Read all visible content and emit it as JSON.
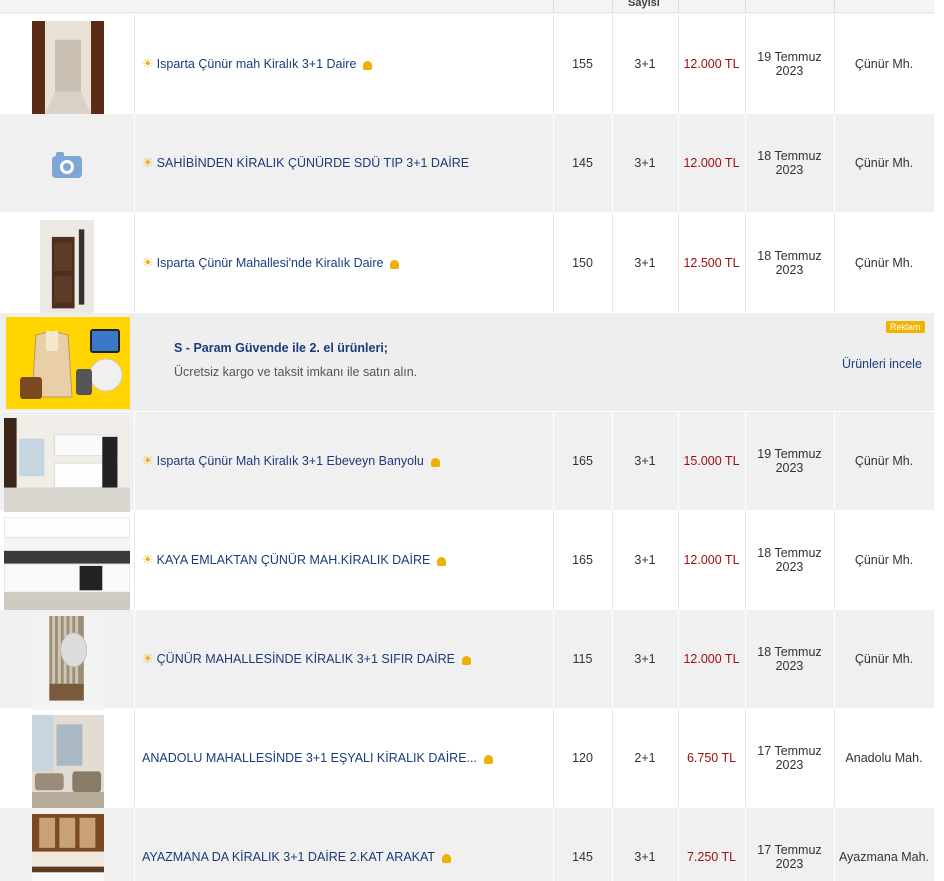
{
  "header": {
    "col_rooms_label": "Sayısı"
  },
  "listings": [
    {
      "title": "Isparta Çünür mah Kiralık 3+1 Daire",
      "featured": true,
      "pinned": true,
      "area": "155",
      "rooms": "3+1",
      "price": "12.000 TL",
      "date_line1": "19 Temmuz",
      "date_line2": "2023",
      "district": "Çünür Mh.",
      "photo": "hallway"
    },
    {
      "title": "SAHİBİNDEN KİRALIK ÇÜNÜRDE SDÜ TIP 3+1 DAİRE",
      "featured": true,
      "pinned": false,
      "area": "145",
      "rooms": "3+1",
      "price": "12.000 TL",
      "date_line1": "18 Temmuz",
      "date_line2": "2023",
      "district": "Çünür Mh.",
      "photo": "camera-icon"
    },
    {
      "title": "Isparta Çünür Mahallesi'nde Kiralık Daire",
      "featured": true,
      "pinned": true,
      "area": "150",
      "rooms": "3+1",
      "price": "12.500 TL",
      "date_line1": "18 Temmuz",
      "date_line2": "2023",
      "district": "Çünür Mh.",
      "photo": "door"
    },
    {
      "title": "Isparta Çünür Mah Kiralık 3+1 Ebeveyn Banyolu",
      "featured": true,
      "pinned": true,
      "area": "165",
      "rooms": "3+1",
      "price": "15.000 TL",
      "date_line1": "19 Temmuz",
      "date_line2": "2023",
      "district": "Çünür Mh.",
      "photo": "kitchen"
    },
    {
      "title": "KAYA EMLAKTAN ÇÜNÜR MAH.KİRALIK DAİRE",
      "featured": true,
      "pinned": true,
      "area": "165",
      "rooms": "3+1",
      "price": "12.000 TL",
      "date_line1": "18 Temmuz",
      "date_line2": "2023",
      "district": "Çünür Mh.",
      "photo": "kitchen2"
    },
    {
      "title": "ÇÜNÜR MAHALLESİNDE KİRALIK 3+1 SIFIR DAİRE",
      "featured": true,
      "pinned": true,
      "area": "115",
      "rooms": "3+1",
      "price": "12.000 TL",
      "date_line1": "18 Temmuz",
      "date_line2": "2023",
      "district": "Çünür Mh.",
      "photo": "mirror"
    },
    {
      "title": "ANADOLU MAHALLESİNDE 3+1 EŞYALI KİRALIK DAİRE...",
      "featured": false,
      "pinned": true,
      "area": "120",
      "rooms": "2+1",
      "price": "6.750 TL",
      "date_line1": "17 Temmuz",
      "date_line2": "2023",
      "district": "Anadolu Mah.",
      "photo": "living"
    },
    {
      "title": "AYAZMANA DA KİRALIK 3+1 DAİRE 2.KAT ARAKAT",
      "featured": false,
      "pinned": true,
      "area": "145",
      "rooms": "3+1",
      "price": "7.250 TL",
      "date_line1": "17 Temmuz",
      "date_line2": "2023",
      "district": "Ayazmana Mah.",
      "photo": "kitchen3"
    }
  ],
  "ad": {
    "title": "S - Param Güvende ile 2. el ürünleri;",
    "text": "Ücretsiz kargo ve taksit imkanı ile satın alın.",
    "badge": "Reklam",
    "link": "Ürünleri incele"
  },
  "colors": {
    "link": "#1a3b7c",
    "price": "#a01010",
    "featured_icon": "#f0a90a",
    "pin_icon": "#f0b000",
    "ad_badge": "#f0b400"
  }
}
